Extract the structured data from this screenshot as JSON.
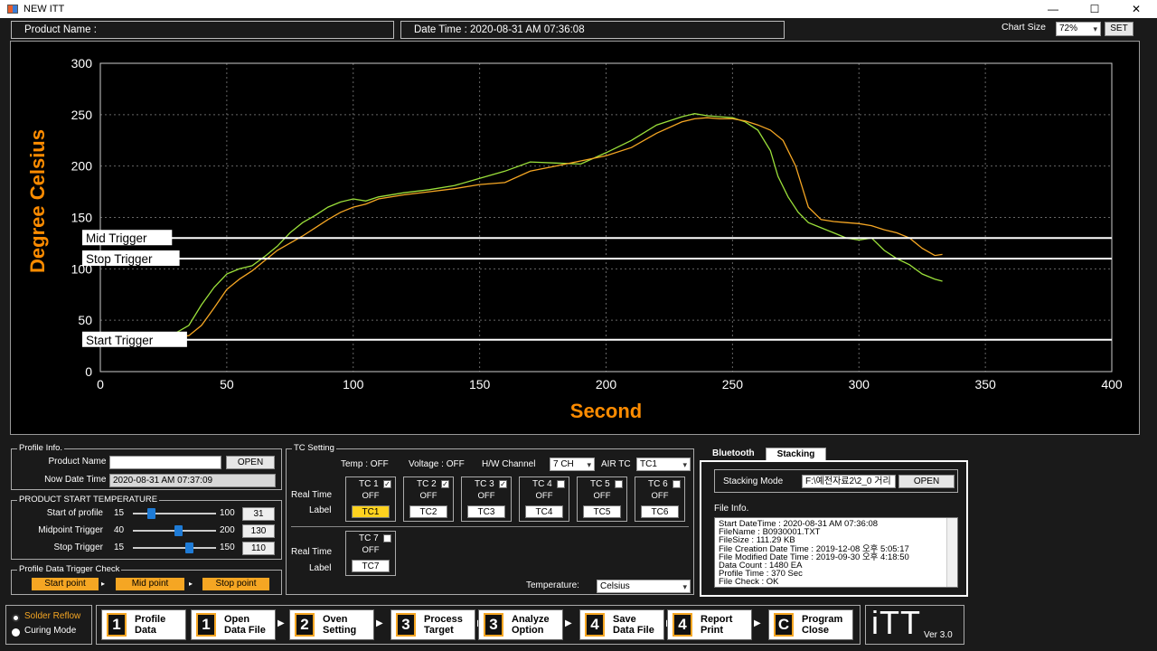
{
  "window": {
    "title": "NEW ITT",
    "min": "—",
    "max": "☐",
    "close": "✕"
  },
  "header": {
    "product_name_label": "Product Name :",
    "date_time_label": "Date Time : 2020-08-31 AM 07:36:08",
    "chart_size_label": "Chart Size",
    "chart_size_value": "72%",
    "set_button": "SET"
  },
  "chart_data": {
    "type": "line",
    "xlabel": "Second",
    "ylabel": "Degree Celsius",
    "xlim": [
      0,
      400
    ],
    "ylim": [
      0,
      300
    ],
    "x_ticks": [
      0,
      50,
      100,
      150,
      200,
      250,
      300,
      350,
      400
    ],
    "y_ticks": [
      0,
      50,
      100,
      150,
      200,
      250,
      300
    ],
    "grid": true,
    "colors": {
      "series_green": "#9be03a",
      "series_orange": "#f5a623",
      "axis_title": "#ff8c00"
    },
    "thresholds": [
      {
        "label": "Mid Trigger",
        "y": 130
      },
      {
        "label": "Stop Trigger",
        "y": 110
      },
      {
        "label": "Start Trigger",
        "y": 31
      }
    ],
    "series": [
      {
        "color": "#9be03a",
        "x": [
          28,
          35,
          40,
          45,
          50,
          55,
          60,
          65,
          70,
          75,
          80,
          85,
          90,
          95,
          100,
          105,
          110,
          120,
          130,
          140,
          150,
          160,
          170,
          180,
          190,
          200,
          210,
          220,
          230,
          235,
          240,
          245,
          250,
          255,
          260,
          265,
          268,
          272,
          276,
          280,
          285,
          290,
          295,
          300,
          305,
          310,
          315,
          320,
          325,
          330,
          333
        ],
        "y": [
          35,
          45,
          65,
          82,
          95,
          100,
          103,
          112,
          122,
          135,
          145,
          152,
          160,
          165,
          168,
          166,
          170,
          174,
          177,
          181,
          188,
          195,
          204,
          203,
          202,
          213,
          225,
          240,
          248,
          251,
          249,
          248,
          247,
          243,
          235,
          215,
          190,
          170,
          155,
          145,
          140,
          135,
          130,
          128,
          130,
          118,
          110,
          104,
          95,
          90,
          88
        ]
      },
      {
        "color": "#f5a623",
        "x": [
          28,
          35,
          40,
          45,
          50,
          55,
          60,
          65,
          70,
          75,
          80,
          85,
          90,
          95,
          100,
          105,
          110,
          120,
          130,
          140,
          150,
          160,
          170,
          180,
          190,
          200,
          210,
          220,
          230,
          235,
          240,
          245,
          250,
          255,
          260,
          265,
          270,
          275,
          280,
          285,
          290,
          295,
          300,
          305,
          310,
          315,
          320,
          325,
          330,
          333
        ],
        "y": [
          33,
          35,
          45,
          62,
          80,
          90,
          98,
          108,
          118,
          125,
          132,
          140,
          148,
          155,
          160,
          163,
          168,
          172,
          175,
          178,
          182,
          184,
          195,
          200,
          205,
          210,
          218,
          232,
          243,
          246,
          247,
          246,
          246,
          244,
          240,
          235,
          225,
          200,
          160,
          148,
          146,
          145,
          144,
          142,
          138,
          135,
          130,
          120,
          113,
          114
        ]
      }
    ]
  },
  "profile_info": {
    "group_title": "Profile Info.",
    "product_name_label": "Product Name :",
    "product_name_value": "",
    "open_button": "OPEN",
    "now_date_label": "Now Date Time :",
    "now_date_value": "2020-08-31 AM 07:37:09"
  },
  "start_temp": {
    "group_title": "PRODUCT START TEMPERATURE",
    "rows": [
      {
        "label": "Start of profile",
        "min": "15",
        "max": "100",
        "value": "31",
        "level": 0.19
      },
      {
        "label": "Midpoint Trigger",
        "min": "40",
        "max": "200",
        "value": "130",
        "level": 0.56
      },
      {
        "label": "Stop Trigger",
        "min": "15",
        "max": "150",
        "value": "110",
        "level": 0.7
      }
    ]
  },
  "trigger_check": {
    "group_title": "Profile Data Trigger Check",
    "start": "Start point",
    "mid": "Mid point",
    "stop": "Stop point",
    "arrow": "▸"
  },
  "tc_setting": {
    "group_title": "TC Setting",
    "temp_label": "Temp :  OFF",
    "voltage_label": "Voltage :  OFF",
    "hw_channel_label": "H/W Channel",
    "hw_channel_value": "7 CH",
    "air_tc_label": "AIR TC",
    "air_tc_value": "TC1",
    "real_time": "Real Time",
    "label": "Label",
    "temperature_label": "Temperature:",
    "temperature_value": "Celsius",
    "channels": [
      {
        "name": "TC 1",
        "checked": true,
        "status": "OFF",
        "label": "TC1"
      },
      {
        "name": "TC 2",
        "checked": true,
        "status": "OFF",
        "label": "TC2"
      },
      {
        "name": "TC 3",
        "checked": true,
        "status": "OFF",
        "label": "TC3"
      },
      {
        "name": "TC 4",
        "checked": false,
        "status": "OFF",
        "label": "TC4"
      },
      {
        "name": "TC 5",
        "checked": false,
        "status": "OFF",
        "label": "TC5"
      },
      {
        "name": "TC 6",
        "checked": false,
        "status": "OFF",
        "label": "TC6"
      },
      {
        "name": "TC 7",
        "checked": false,
        "status": "OFF",
        "label": "TC7"
      }
    ]
  },
  "stacking": {
    "tab_bluetooth": "Bluetooth",
    "tab_stacking": "Stacking",
    "mode_label": "Stacking Mode",
    "path_value": "F:\\예전자료2\\2_0 거리",
    "open_button": "OPEN",
    "file_info_label": "File Info.",
    "file_info_lines": [
      "Start DateTime : 2020-08-31 AM 07:36:08",
      "FileName : B0930001.TXT",
      "FileSize : 111.29 KB",
      "File Creation Date Time : 2019-12-08 오후 5:05:17",
      "File Modified Date Time : 2019-09-30 오후 4:18:50",
      "Data Count : 1480 EA",
      "Profile Time : 370 Sec",
      "File Check : OK"
    ]
  },
  "mode": {
    "solder_reflow": "Solder Reflow",
    "curing_mode": "Curing Mode"
  },
  "steps": [
    {
      "num": "1",
      "text": "Profile\nData"
    },
    {
      "num": "1",
      "text": "Open\nData File"
    },
    {
      "num": "2",
      "text": "Oven\nSetting"
    },
    {
      "num": "3",
      "text": "Process\nTarget"
    },
    {
      "num": "3",
      "text": "Analyze\nOption"
    },
    {
      "num": "4",
      "text": "Save\nData File"
    },
    {
      "num": "4",
      "text": "Report\nPrint"
    },
    {
      "num": "C",
      "text": "Program\nClose"
    }
  ],
  "brand": {
    "logo": "iTT",
    "version": "Ver 3.0"
  }
}
